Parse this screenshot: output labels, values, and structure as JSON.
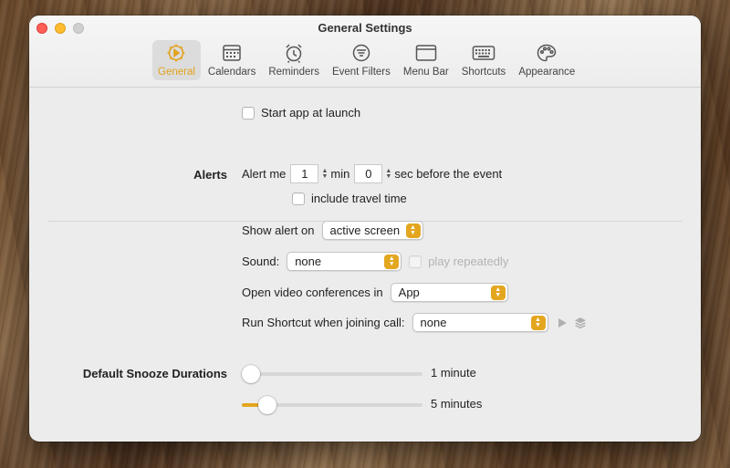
{
  "window": {
    "title": "General Settings"
  },
  "toolbar": {
    "items": [
      {
        "label": "General",
        "icon": "gear-icon",
        "active": true
      },
      {
        "label": "Calendars",
        "icon": "calendar-icon"
      },
      {
        "label": "Reminders",
        "icon": "alarm-clock-icon"
      },
      {
        "label": "Event Filters",
        "icon": "filter-icon"
      },
      {
        "label": "Menu Bar",
        "icon": "window-icon"
      },
      {
        "label": "Shortcuts",
        "icon": "keyboard-icon"
      },
      {
        "label": "Appearance",
        "icon": "palette-icon"
      }
    ]
  },
  "general": {
    "start_at_launch_label": "Start app at launch"
  },
  "alerts": {
    "section_label": "Alerts",
    "alert_me_label": "Alert me",
    "min_value": "1",
    "min_label": "min",
    "sec_value": "0",
    "sec_label": "sec before the event",
    "travel_time_label": "include travel time",
    "show_alert_on_label": "Show alert on",
    "show_alert_on_value": "active screen",
    "sound_label": "Sound:",
    "sound_value": "none",
    "play_repeatedly_label": "play repeatedly",
    "open_video_label": "Open video conferences in",
    "open_video_value": "App",
    "run_shortcut_label": "Run Shortcut when joining call:",
    "run_shortcut_value": "none"
  },
  "snooze": {
    "section_label": "Default Snooze Durations",
    "sliders": [
      {
        "label": "1 minute",
        "level": 0.0
      },
      {
        "label": "5 minutes",
        "level": 0.1
      }
    ]
  },
  "colors": {
    "accent": "#e3a61f",
    "window_bg": "#ececec"
  }
}
